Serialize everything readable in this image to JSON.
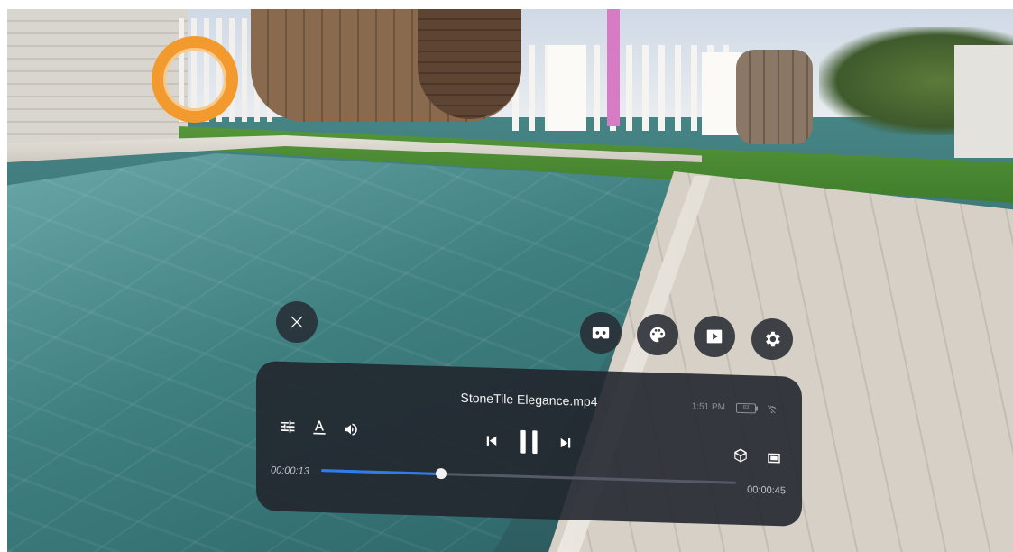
{
  "player": {
    "file_name": "StoneTile Elegance.mp4",
    "clock": "1:51 PM",
    "battery_text": "83",
    "current_time": "00:00:13",
    "total_time": "00:00:45",
    "progress_fraction": 0.29,
    "accent_color": "#2d7cf2"
  },
  "icons": {
    "close": "close-icon",
    "vr_view": "vr-view-icon",
    "palette": "palette-icon",
    "play_box": "video-play-icon",
    "settings": "gear-icon",
    "adjust": "adjust-sliders-icon",
    "subtitles": "subtitle-icon",
    "volume": "volume-icon",
    "previous": "skip-previous-icon",
    "pause": "pause-icon",
    "next": "skip-next-icon",
    "mode_3d": "cube-icon",
    "screen": "screen-mode-icon",
    "wifi_off": "wifi-off-icon"
  }
}
